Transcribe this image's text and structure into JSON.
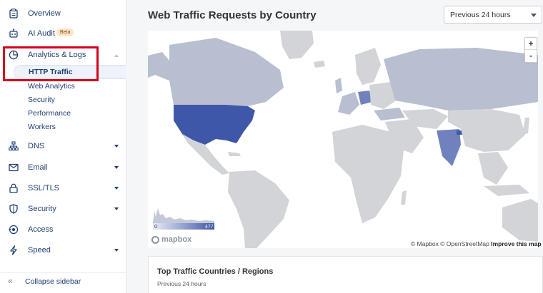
{
  "sidebar": {
    "items": [
      {
        "label": "Overview",
        "icon": "clipboard-icon"
      },
      {
        "label": "AI Audit",
        "icon": "robot-icon",
        "badge": "Beta"
      },
      {
        "label": "Analytics & Logs",
        "icon": "pie-chart-icon",
        "expanded": true
      },
      {
        "label": "DNS",
        "icon": "network-icon"
      },
      {
        "label": "Email",
        "icon": "envelope-icon"
      },
      {
        "label": "SSL/TLS",
        "icon": "lock-icon"
      },
      {
        "label": "Security",
        "icon": "shield-icon"
      },
      {
        "label": "Access",
        "icon": "access-icon"
      },
      {
        "label": "Speed",
        "icon": "lightning-icon"
      }
    ],
    "subitems": [
      "HTTP Traffic",
      "Web Analytics",
      "Security",
      "Performance",
      "Workers"
    ],
    "active_subitem": "HTTP Traffic",
    "collapse_label": "Collapse sidebar"
  },
  "main": {
    "title": "Web Traffic Requests by Country",
    "time_select": "Previous 24 hours",
    "map": {
      "zoom_in": "+",
      "zoom_out": "-",
      "legend_min": "0",
      "legend_max": "477",
      "logo": "mapbox",
      "attribution": "© Mapbox © OpenStreetMap",
      "attribution_link": "Improve this map"
    },
    "card": {
      "title": "Top Traffic Countries / Regions",
      "subtitle": "Previous 24 hours"
    }
  },
  "colors": {
    "accent": "#1f3e73",
    "highlight": "#d6001c",
    "map_land": "#d2d4d7",
    "map_low": "#b7bfd1",
    "map_high": "#3f57a8"
  }
}
